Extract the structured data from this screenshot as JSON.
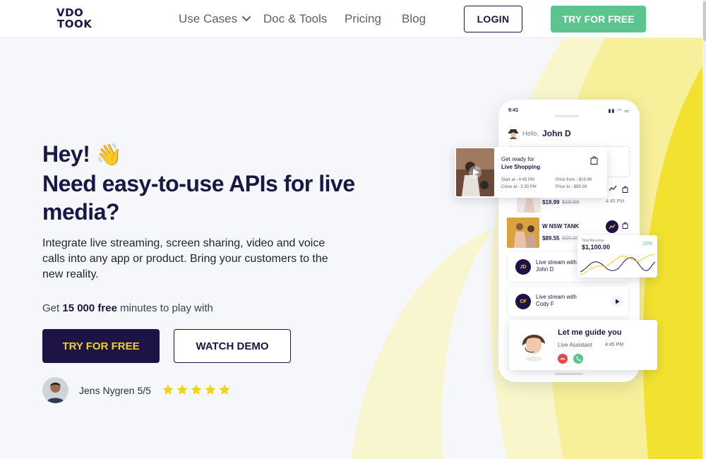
{
  "brand": {
    "logo_line1": "VDO",
    "logo_line2": "TOOK"
  },
  "nav": {
    "links": [
      "Use Cases",
      "Doc & Tools",
      "Pricing",
      "Blog"
    ],
    "login": "LOGIN",
    "try_free": "TRY FOR FREE"
  },
  "hero": {
    "greeting": "Hey!",
    "wave_emoji": "👋",
    "headline": "Need easy-to-use APIs for live media?",
    "subtitle": "Integrate live streaming, screen sharing, video and voice calls into any app or product. Bring your customers to the new reality.",
    "free_prefix": "Get",
    "free_amount": "15 000 free",
    "free_suffix": "minutes to play with",
    "cta_primary": "TRY FOR FREE",
    "cta_secondary": "WATCH DEMO",
    "review": {
      "name": "Jens Nygren 5/5",
      "rating": 5,
      "max_rating": 5
    }
  },
  "phone": {
    "time": "9:41",
    "hello": "Hello,",
    "user": "John D",
    "shop_card": {
      "title1": "Get ready for",
      "title2": "Live Shopping",
      "start": "Start at - 4:45 PM",
      "close": "Close at - 5:30 PM",
      "price_from": "Price from - $19.99",
      "price_to": "Price to - $89.99"
    },
    "products": [
      {
        "price": "$19.99",
        "old_price": "$19.99",
        "time": "4:45 PM"
      },
      {
        "name": "W NSW TANK",
        "price": "$89.55",
        "old_price": "$99.99"
      }
    ],
    "earnings": {
      "label": "Total Revenue",
      "value": "$1,100.00",
      "change": "15%"
    },
    "live_streams": [
      {
        "initials": "JD",
        "title": "Live stream with",
        "name": "John D"
      },
      {
        "initials": "CF",
        "title": "Live stream with",
        "name": "Cody F"
      }
    ],
    "guide": {
      "title": "Let me guide you",
      "role": "Live Assistant",
      "time": "4:45 PM"
    }
  },
  "colors": {
    "brand_dark": "#1d1445",
    "brand_yellow": "#f2d21d",
    "brand_green": "#5cc48e"
  }
}
